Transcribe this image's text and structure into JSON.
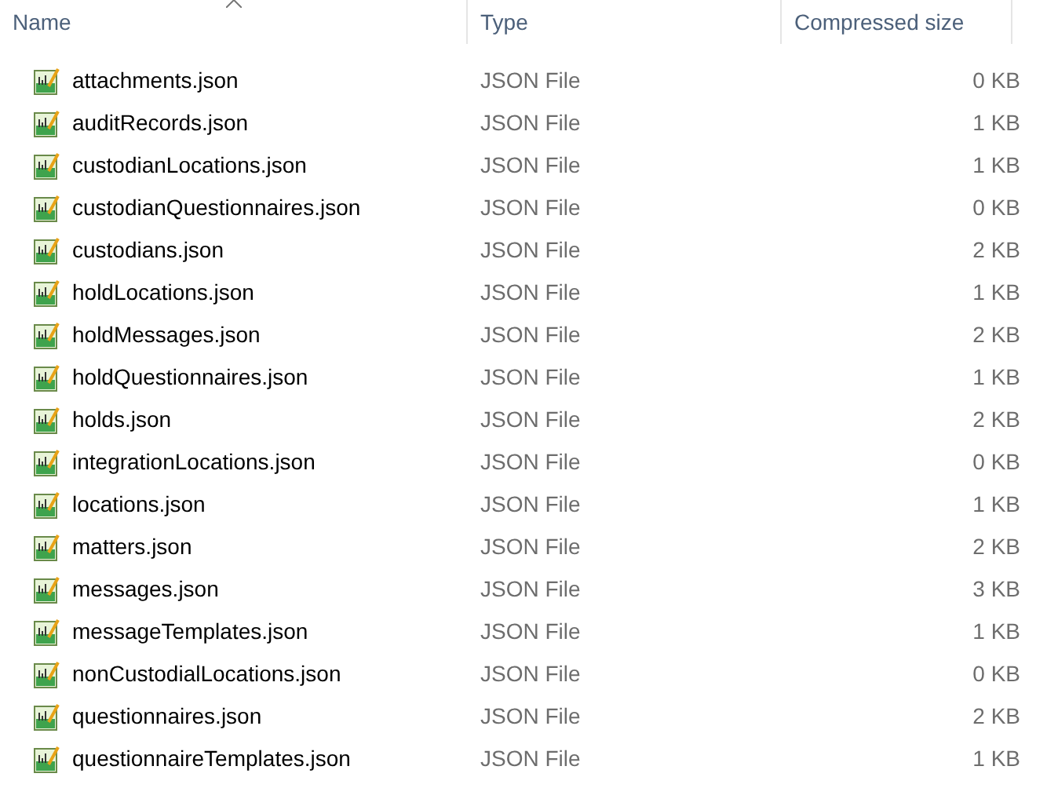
{
  "columns": [
    {
      "label": "Name",
      "sorted": true
    },
    {
      "label": "Type",
      "sorted": false
    },
    {
      "label": "Compressed size",
      "sorted": false
    }
  ],
  "rows": [
    {
      "name": "attachments.json",
      "type": "JSON File",
      "size": "0 KB"
    },
    {
      "name": "auditRecords.json",
      "type": "JSON File",
      "size": "1 KB"
    },
    {
      "name": "custodianLocations.json",
      "type": "JSON File",
      "size": "1 KB"
    },
    {
      "name": "custodianQuestionnaires.json",
      "type": "JSON File",
      "size": "0 KB"
    },
    {
      "name": "custodians.json",
      "type": "JSON File",
      "size": "2 KB"
    },
    {
      "name": "holdLocations.json",
      "type": "JSON File",
      "size": "1 KB"
    },
    {
      "name": "holdMessages.json",
      "type": "JSON File",
      "size": "2 KB"
    },
    {
      "name": "holdQuestionnaires.json",
      "type": "JSON File",
      "size": "1 KB"
    },
    {
      "name": "holds.json",
      "type": "JSON File",
      "size": "2 KB"
    },
    {
      "name": "integrationLocations.json",
      "type": "JSON File",
      "size": "0 KB"
    },
    {
      "name": "locations.json",
      "type": "JSON File",
      "size": "1 KB"
    },
    {
      "name": "matters.json",
      "type": "JSON File",
      "size": "2 KB"
    },
    {
      "name": "messages.json",
      "type": "JSON File",
      "size": "3 KB"
    },
    {
      "name": "messageTemplates.json",
      "type": "JSON File",
      "size": "1 KB"
    },
    {
      "name": "nonCustodialLocations.json",
      "type": "JSON File",
      "size": "0 KB"
    },
    {
      "name": "questionnaires.json",
      "type": "JSON File",
      "size": "2 KB"
    },
    {
      "name": "questionnaireTemplates.json",
      "type": "JSON File",
      "size": "1 KB"
    }
  ]
}
